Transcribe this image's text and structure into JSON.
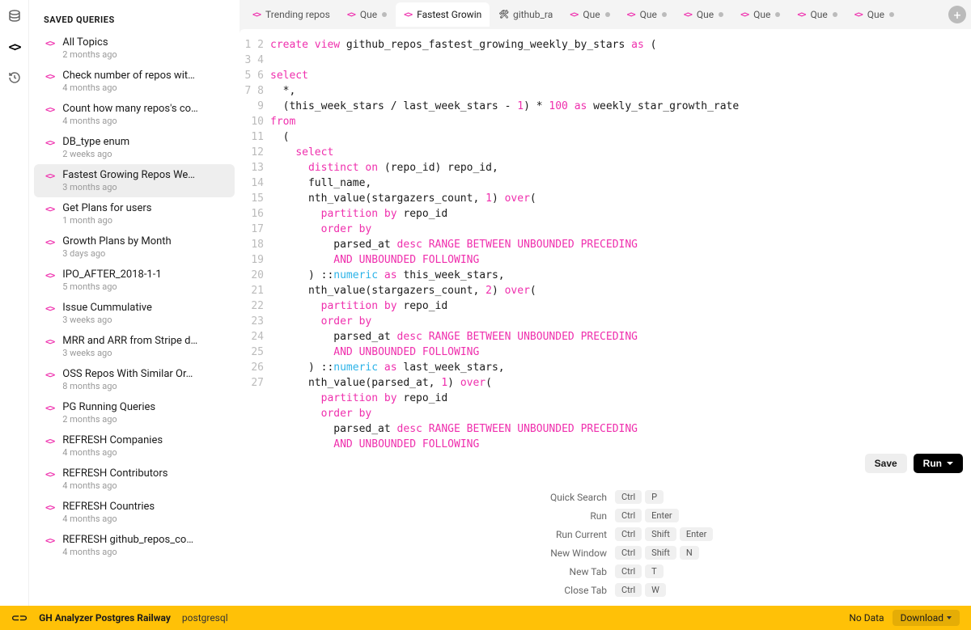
{
  "sidebar": {
    "title": "SAVED QUERIES",
    "items": [
      {
        "name": "All Topics",
        "meta": "2 months ago",
        "active": false
      },
      {
        "name": "Check number of repos wit…",
        "meta": "4 months ago",
        "active": false
      },
      {
        "name": "Count how many repos's co…",
        "meta": "4 months ago",
        "active": false
      },
      {
        "name": "DB_type enum",
        "meta": "2 weeks ago",
        "active": false
      },
      {
        "name": "Fastest Growing Repos We…",
        "meta": "3 months ago",
        "active": true
      },
      {
        "name": "Get Plans for users",
        "meta": "1 month ago",
        "active": false
      },
      {
        "name": "Growth Plans by Month",
        "meta": "3 days ago",
        "active": false
      },
      {
        "name": "IPO_AFTER_2018-1-1",
        "meta": "5 months ago",
        "active": false
      },
      {
        "name": "Issue Cummulative",
        "meta": "3 weeks ago",
        "active": false
      },
      {
        "name": "MRR and ARR from Stripe d…",
        "meta": "3 weeks ago",
        "active": false
      },
      {
        "name": "OSS Repos With Similar Or…",
        "meta": "8 months ago",
        "active": false
      },
      {
        "name": "PG Running Queries",
        "meta": "2 months ago",
        "active": false
      },
      {
        "name": "REFRESH Companies",
        "meta": "4 months ago",
        "active": false
      },
      {
        "name": "REFRESH Contributors",
        "meta": "4 months ago",
        "active": false
      },
      {
        "name": "REFRESH Countries",
        "meta": "4 months ago",
        "active": false
      },
      {
        "name": "REFRESH github_repos_co…",
        "meta": "4 months ago",
        "active": false
      }
    ]
  },
  "tabs": [
    {
      "label": "Trending repos",
      "icon": "code",
      "active": false,
      "dirty": false
    },
    {
      "label": "Que",
      "icon": "code",
      "active": false,
      "dirty": true
    },
    {
      "label": "Fastest Growin",
      "icon": "code",
      "active": true,
      "dirty": false
    },
    {
      "label": "github_ra",
      "icon": "tools",
      "active": false,
      "dirty": false
    },
    {
      "label": "Que",
      "icon": "code",
      "active": false,
      "dirty": true
    },
    {
      "label": "Que",
      "icon": "code",
      "active": false,
      "dirty": true
    },
    {
      "label": "Que",
      "icon": "code",
      "active": false,
      "dirty": true
    },
    {
      "label": "Que",
      "icon": "code",
      "active": false,
      "dirty": true
    },
    {
      "label": "Que",
      "icon": "code",
      "active": false,
      "dirty": true
    },
    {
      "label": "Que",
      "icon": "code",
      "active": false,
      "dirty": true
    }
  ],
  "code": {
    "lines": [
      [
        {
          "t": "create",
          "c": "kw"
        },
        {
          "t": " "
        },
        {
          "t": "view",
          "c": "kw"
        },
        {
          "t": " github_repos_fastest_growing_weekly_by_stars "
        },
        {
          "t": "as",
          "c": "kw"
        },
        {
          "t": " ("
        }
      ],
      [],
      [
        {
          "t": "select",
          "c": "kw"
        }
      ],
      [
        {
          "t": "  *,"
        }
      ],
      [
        {
          "t": "  (this_week_stars / last_week_stars - "
        },
        {
          "t": "1",
          "c": "num"
        },
        {
          "t": ") * "
        },
        {
          "t": "100",
          "c": "num"
        },
        {
          "t": " "
        },
        {
          "t": "as",
          "c": "kw"
        },
        {
          "t": " weekly_star_growth_rate"
        }
      ],
      [
        {
          "t": "from",
          "c": "kw"
        }
      ],
      [
        {
          "t": "  ("
        }
      ],
      [
        {
          "t": "    "
        },
        {
          "t": "select",
          "c": "kw"
        }
      ],
      [
        {
          "t": "      "
        },
        {
          "t": "distinct",
          "c": "kw"
        },
        {
          "t": " "
        },
        {
          "t": "on",
          "c": "kw"
        },
        {
          "t": " (repo_id) repo_id,"
        }
      ],
      [
        {
          "t": "      full_name,"
        }
      ],
      [
        {
          "t": "      nth_value(stargazers_count, "
        },
        {
          "t": "1",
          "c": "num"
        },
        {
          "t": ") "
        },
        {
          "t": "over",
          "c": "kw"
        },
        {
          "t": "("
        }
      ],
      [
        {
          "t": "        "
        },
        {
          "t": "partition",
          "c": "kw"
        },
        {
          "t": " "
        },
        {
          "t": "by",
          "c": "kw"
        },
        {
          "t": " repo_id"
        }
      ],
      [
        {
          "t": "        "
        },
        {
          "t": "order",
          "c": "kw"
        },
        {
          "t": " "
        },
        {
          "t": "by",
          "c": "kw"
        }
      ],
      [
        {
          "t": "          parsed_at "
        },
        {
          "t": "desc",
          "c": "kw"
        },
        {
          "t": " "
        },
        {
          "t": "RANGE",
          "c": "kw"
        },
        {
          "t": " "
        },
        {
          "t": "BETWEEN",
          "c": "kw"
        },
        {
          "t": " "
        },
        {
          "t": "UNBOUNDED",
          "c": "kw"
        },
        {
          "t": " "
        },
        {
          "t": "PRECEDING",
          "c": "kw"
        }
      ],
      [
        {
          "t": "          "
        },
        {
          "t": "AND",
          "c": "kw"
        },
        {
          "t": " "
        },
        {
          "t": "UNBOUNDED",
          "c": "kw"
        },
        {
          "t": " "
        },
        {
          "t": "FOLLOWING",
          "c": "kw"
        }
      ],
      [
        {
          "t": "      ) ::"
        },
        {
          "t": "numeric",
          "c": "type"
        },
        {
          "t": " "
        },
        {
          "t": "as",
          "c": "kw"
        },
        {
          "t": " this_week_stars,"
        }
      ],
      [
        {
          "t": "      nth_value(stargazers_count, "
        },
        {
          "t": "2",
          "c": "num"
        },
        {
          "t": ") "
        },
        {
          "t": "over",
          "c": "kw"
        },
        {
          "t": "("
        }
      ],
      [
        {
          "t": "        "
        },
        {
          "t": "partition",
          "c": "kw"
        },
        {
          "t": " "
        },
        {
          "t": "by",
          "c": "kw"
        },
        {
          "t": " repo_id"
        }
      ],
      [
        {
          "t": "        "
        },
        {
          "t": "order",
          "c": "kw"
        },
        {
          "t": " "
        },
        {
          "t": "by",
          "c": "kw"
        }
      ],
      [
        {
          "t": "          parsed_at "
        },
        {
          "t": "desc",
          "c": "kw"
        },
        {
          "t": " "
        },
        {
          "t": "RANGE",
          "c": "kw"
        },
        {
          "t": " "
        },
        {
          "t": "BETWEEN",
          "c": "kw"
        },
        {
          "t": " "
        },
        {
          "t": "UNBOUNDED",
          "c": "kw"
        },
        {
          "t": " "
        },
        {
          "t": "PRECEDING",
          "c": "kw"
        }
      ],
      [
        {
          "t": "          "
        },
        {
          "t": "AND",
          "c": "kw"
        },
        {
          "t": " "
        },
        {
          "t": "UNBOUNDED",
          "c": "kw"
        },
        {
          "t": " "
        },
        {
          "t": "FOLLOWING",
          "c": "kw"
        }
      ],
      [
        {
          "t": "      ) ::"
        },
        {
          "t": "numeric",
          "c": "type"
        },
        {
          "t": " "
        },
        {
          "t": "as",
          "c": "kw"
        },
        {
          "t": " last_week_stars,"
        }
      ],
      [
        {
          "t": "      nth_value(parsed_at, "
        },
        {
          "t": "1",
          "c": "num"
        },
        {
          "t": ") "
        },
        {
          "t": "over",
          "c": "kw"
        },
        {
          "t": "("
        }
      ],
      [
        {
          "t": "        "
        },
        {
          "t": "partition",
          "c": "kw"
        },
        {
          "t": " "
        },
        {
          "t": "by",
          "c": "kw"
        },
        {
          "t": " repo_id"
        }
      ],
      [
        {
          "t": "        "
        },
        {
          "t": "order",
          "c": "kw"
        },
        {
          "t": " "
        },
        {
          "t": "by",
          "c": "kw"
        }
      ],
      [
        {
          "t": "          parsed_at "
        },
        {
          "t": "desc",
          "c": "kw"
        },
        {
          "t": " "
        },
        {
          "t": "RANGE",
          "c": "kw"
        },
        {
          "t": " "
        },
        {
          "t": "BETWEEN",
          "c": "kw"
        },
        {
          "t": " "
        },
        {
          "t": "UNBOUNDED",
          "c": "kw"
        },
        {
          "t": " "
        },
        {
          "t": "PRECEDING",
          "c": "kw"
        }
      ],
      [
        {
          "t": "          "
        },
        {
          "t": "AND",
          "c": "kw"
        },
        {
          "t": " "
        },
        {
          "t": "UNBOUNDED",
          "c": "kw"
        },
        {
          "t": " "
        },
        {
          "t": "FOLLOWING",
          "c": "kw"
        }
      ]
    ]
  },
  "actions": {
    "save": "Save",
    "run": "Run"
  },
  "shortcuts": [
    {
      "label": "Quick Search",
      "keys": [
        "Ctrl",
        "P"
      ]
    },
    {
      "label": "Run",
      "keys": [
        "Ctrl",
        "Enter"
      ]
    },
    {
      "label": "Run Current",
      "keys": [
        "Ctrl",
        "Shift",
        "Enter"
      ]
    },
    {
      "label": "New Window",
      "keys": [
        "Ctrl",
        "Shift",
        "N"
      ]
    },
    {
      "label": "New Tab",
      "keys": [
        "Ctrl",
        "T"
      ]
    },
    {
      "label": "Close Tab",
      "keys": [
        "Ctrl",
        "W"
      ]
    }
  ],
  "status": {
    "connection": "GH Analyzer Postgres Railway",
    "driver": "postgresql",
    "nodata": "No Data",
    "download": "Download"
  }
}
